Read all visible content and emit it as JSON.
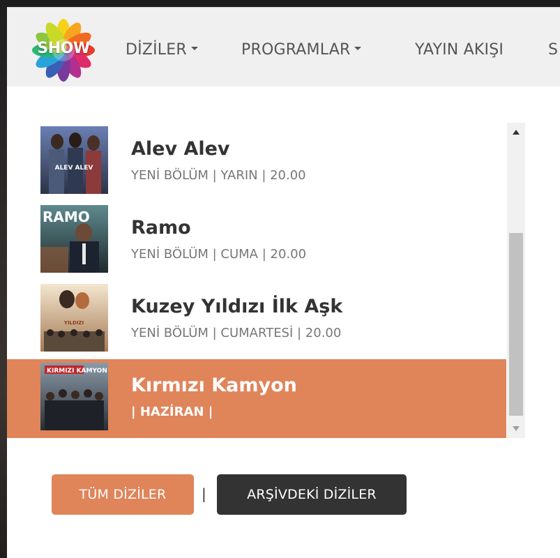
{
  "brand": {
    "logo_text": "SHOW",
    "accent_color": "#e0845a",
    "dark_button_color": "#333333"
  },
  "nav": {
    "items": [
      {
        "label": "DİZİLER",
        "has_caret": true
      },
      {
        "label": "PROGRAMLAR",
        "has_caret": true
      },
      {
        "label": "YAYIN AKIŞI",
        "has_caret": false
      },
      {
        "label": "S",
        "has_caret": false
      }
    ]
  },
  "dropdown": {
    "shows": [
      {
        "title": "Alev Alev",
        "subtitle": "YENİ BÖLÜM | YARIN | 20.00",
        "thumb_text": "ALEV ALEV",
        "active": false
      },
      {
        "title": "Ramo",
        "subtitle": "YENİ BÖLÜM | CUMA | 20.00",
        "thumb_text": "RAMO",
        "active": false
      },
      {
        "title": "Kuzey Yıldızı İlk Aşk",
        "subtitle": "YENİ BÖLÜM | CUMARTESİ | 20.00",
        "thumb_text": "YILDIZI",
        "active": false
      },
      {
        "title": "Kırmızı Kamyon",
        "subtitle": "| HAZİRAN |",
        "thumb_text": "KIRMIZI KAMYON",
        "active": true
      }
    ],
    "all_shows_label": "TÜM DİZİLER",
    "separator": "|",
    "archive_label": "ARŞİVDEKİ DİZİLER"
  }
}
